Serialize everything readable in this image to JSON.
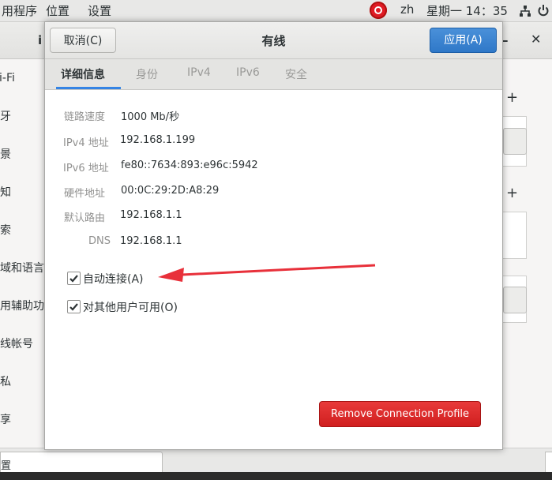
{
  "topbar": {
    "apps_menu": "用程序",
    "places_menu": "位置",
    "settings_menu": "设置",
    "language": "zh",
    "clock": "星期一 14：35"
  },
  "settings_bg": {
    "title_partial": "i",
    "sidebar_items": [
      "Fi-Fi",
      "牙",
      "景",
      "知",
      "索",
      "域和语言",
      "用辅助功",
      "线帐号",
      "私",
      "享"
    ],
    "bottom_field": "置"
  },
  "dialog": {
    "title": "有线",
    "cancel_label": "取消(C)",
    "apply_label": "应用(A)",
    "tabs": [
      "详细信息",
      "身份",
      "IPv4",
      "IPv6",
      "安全"
    ],
    "details": [
      {
        "label": "链路速度",
        "value": "1000 Mb/秒"
      },
      {
        "label": "IPv4 地址",
        "value": "192.168.1.199"
      },
      {
        "label": "IPv6 地址",
        "value": "fe80::7634:893:e96c:5942"
      },
      {
        "label": "硬件地址",
        "value": "00:0C:29:2D:A8:29"
      },
      {
        "label": "默认路由",
        "value": "192.168.1.1"
      },
      {
        "label": "DNS",
        "value": "192.168.1.1"
      }
    ],
    "auto_connect": {
      "label": "自动连接(A)",
      "checked": true
    },
    "all_users": {
      "label": "对其他用户可用(O)",
      "checked": true
    },
    "remove_label": "Remove Connection Profile"
  },
  "colors": {
    "accent": "#3584e4",
    "destructive": "#d01f1f",
    "annotation": "#e8303a"
  },
  "icons": [
    "app-indicator-icon",
    "network-icon",
    "power-icon",
    "checkmark-icon",
    "close-icon",
    "add-icon"
  ]
}
